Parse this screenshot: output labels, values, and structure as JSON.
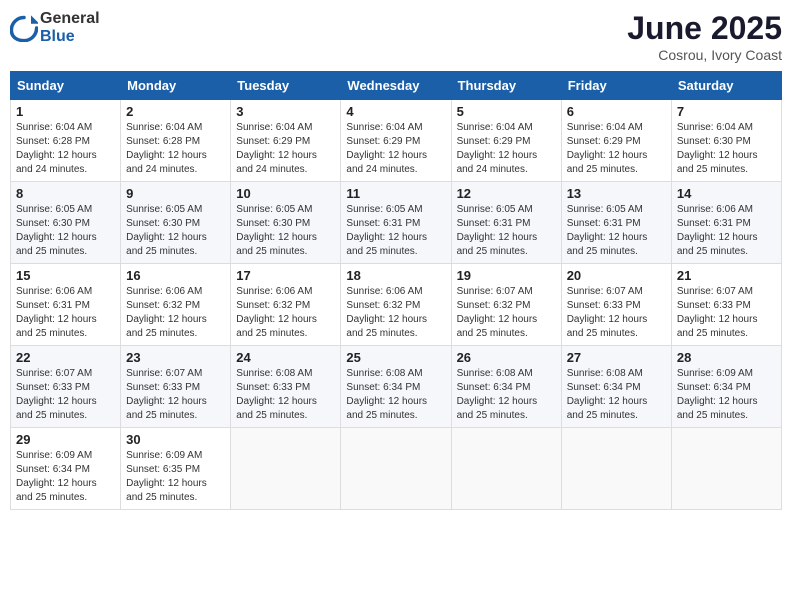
{
  "header": {
    "logo_general": "General",
    "logo_blue": "Blue",
    "month_title": "June 2025",
    "location": "Cosrou, Ivory Coast"
  },
  "weekdays": [
    "Sunday",
    "Monday",
    "Tuesday",
    "Wednesday",
    "Thursday",
    "Friday",
    "Saturday"
  ],
  "weeks": [
    [
      {
        "day": "1",
        "info": "Sunrise: 6:04 AM\nSunset: 6:28 PM\nDaylight: 12 hours\nand 24 minutes."
      },
      {
        "day": "2",
        "info": "Sunrise: 6:04 AM\nSunset: 6:28 PM\nDaylight: 12 hours\nand 24 minutes."
      },
      {
        "day": "3",
        "info": "Sunrise: 6:04 AM\nSunset: 6:29 PM\nDaylight: 12 hours\nand 24 minutes."
      },
      {
        "day": "4",
        "info": "Sunrise: 6:04 AM\nSunset: 6:29 PM\nDaylight: 12 hours\nand 24 minutes."
      },
      {
        "day": "5",
        "info": "Sunrise: 6:04 AM\nSunset: 6:29 PM\nDaylight: 12 hours\nand 24 minutes."
      },
      {
        "day": "6",
        "info": "Sunrise: 6:04 AM\nSunset: 6:29 PM\nDaylight: 12 hours\nand 25 minutes."
      },
      {
        "day": "7",
        "info": "Sunrise: 6:04 AM\nSunset: 6:30 PM\nDaylight: 12 hours\nand 25 minutes."
      }
    ],
    [
      {
        "day": "8",
        "info": "Sunrise: 6:05 AM\nSunset: 6:30 PM\nDaylight: 12 hours\nand 25 minutes."
      },
      {
        "day": "9",
        "info": "Sunrise: 6:05 AM\nSunset: 6:30 PM\nDaylight: 12 hours\nand 25 minutes."
      },
      {
        "day": "10",
        "info": "Sunrise: 6:05 AM\nSunset: 6:30 PM\nDaylight: 12 hours\nand 25 minutes."
      },
      {
        "day": "11",
        "info": "Sunrise: 6:05 AM\nSunset: 6:31 PM\nDaylight: 12 hours\nand 25 minutes."
      },
      {
        "day": "12",
        "info": "Sunrise: 6:05 AM\nSunset: 6:31 PM\nDaylight: 12 hours\nand 25 minutes."
      },
      {
        "day": "13",
        "info": "Sunrise: 6:05 AM\nSunset: 6:31 PM\nDaylight: 12 hours\nand 25 minutes."
      },
      {
        "day": "14",
        "info": "Sunrise: 6:06 AM\nSunset: 6:31 PM\nDaylight: 12 hours\nand 25 minutes."
      }
    ],
    [
      {
        "day": "15",
        "info": "Sunrise: 6:06 AM\nSunset: 6:31 PM\nDaylight: 12 hours\nand 25 minutes."
      },
      {
        "day": "16",
        "info": "Sunrise: 6:06 AM\nSunset: 6:32 PM\nDaylight: 12 hours\nand 25 minutes."
      },
      {
        "day": "17",
        "info": "Sunrise: 6:06 AM\nSunset: 6:32 PM\nDaylight: 12 hours\nand 25 minutes."
      },
      {
        "day": "18",
        "info": "Sunrise: 6:06 AM\nSunset: 6:32 PM\nDaylight: 12 hours\nand 25 minutes."
      },
      {
        "day": "19",
        "info": "Sunrise: 6:07 AM\nSunset: 6:32 PM\nDaylight: 12 hours\nand 25 minutes."
      },
      {
        "day": "20",
        "info": "Sunrise: 6:07 AM\nSunset: 6:33 PM\nDaylight: 12 hours\nand 25 minutes."
      },
      {
        "day": "21",
        "info": "Sunrise: 6:07 AM\nSunset: 6:33 PM\nDaylight: 12 hours\nand 25 minutes."
      }
    ],
    [
      {
        "day": "22",
        "info": "Sunrise: 6:07 AM\nSunset: 6:33 PM\nDaylight: 12 hours\nand 25 minutes."
      },
      {
        "day": "23",
        "info": "Sunrise: 6:07 AM\nSunset: 6:33 PM\nDaylight: 12 hours\nand 25 minutes."
      },
      {
        "day": "24",
        "info": "Sunrise: 6:08 AM\nSunset: 6:33 PM\nDaylight: 12 hours\nand 25 minutes."
      },
      {
        "day": "25",
        "info": "Sunrise: 6:08 AM\nSunset: 6:34 PM\nDaylight: 12 hours\nand 25 minutes."
      },
      {
        "day": "26",
        "info": "Sunrise: 6:08 AM\nSunset: 6:34 PM\nDaylight: 12 hours\nand 25 minutes."
      },
      {
        "day": "27",
        "info": "Sunrise: 6:08 AM\nSunset: 6:34 PM\nDaylight: 12 hours\nand 25 minutes."
      },
      {
        "day": "28",
        "info": "Sunrise: 6:09 AM\nSunset: 6:34 PM\nDaylight: 12 hours\nand 25 minutes."
      }
    ],
    [
      {
        "day": "29",
        "info": "Sunrise: 6:09 AM\nSunset: 6:34 PM\nDaylight: 12 hours\nand 25 minutes."
      },
      {
        "day": "30",
        "info": "Sunrise: 6:09 AM\nSunset: 6:35 PM\nDaylight: 12 hours\nand 25 minutes."
      },
      {
        "day": "",
        "info": ""
      },
      {
        "day": "",
        "info": ""
      },
      {
        "day": "",
        "info": ""
      },
      {
        "day": "",
        "info": ""
      },
      {
        "day": "",
        "info": ""
      }
    ]
  ]
}
